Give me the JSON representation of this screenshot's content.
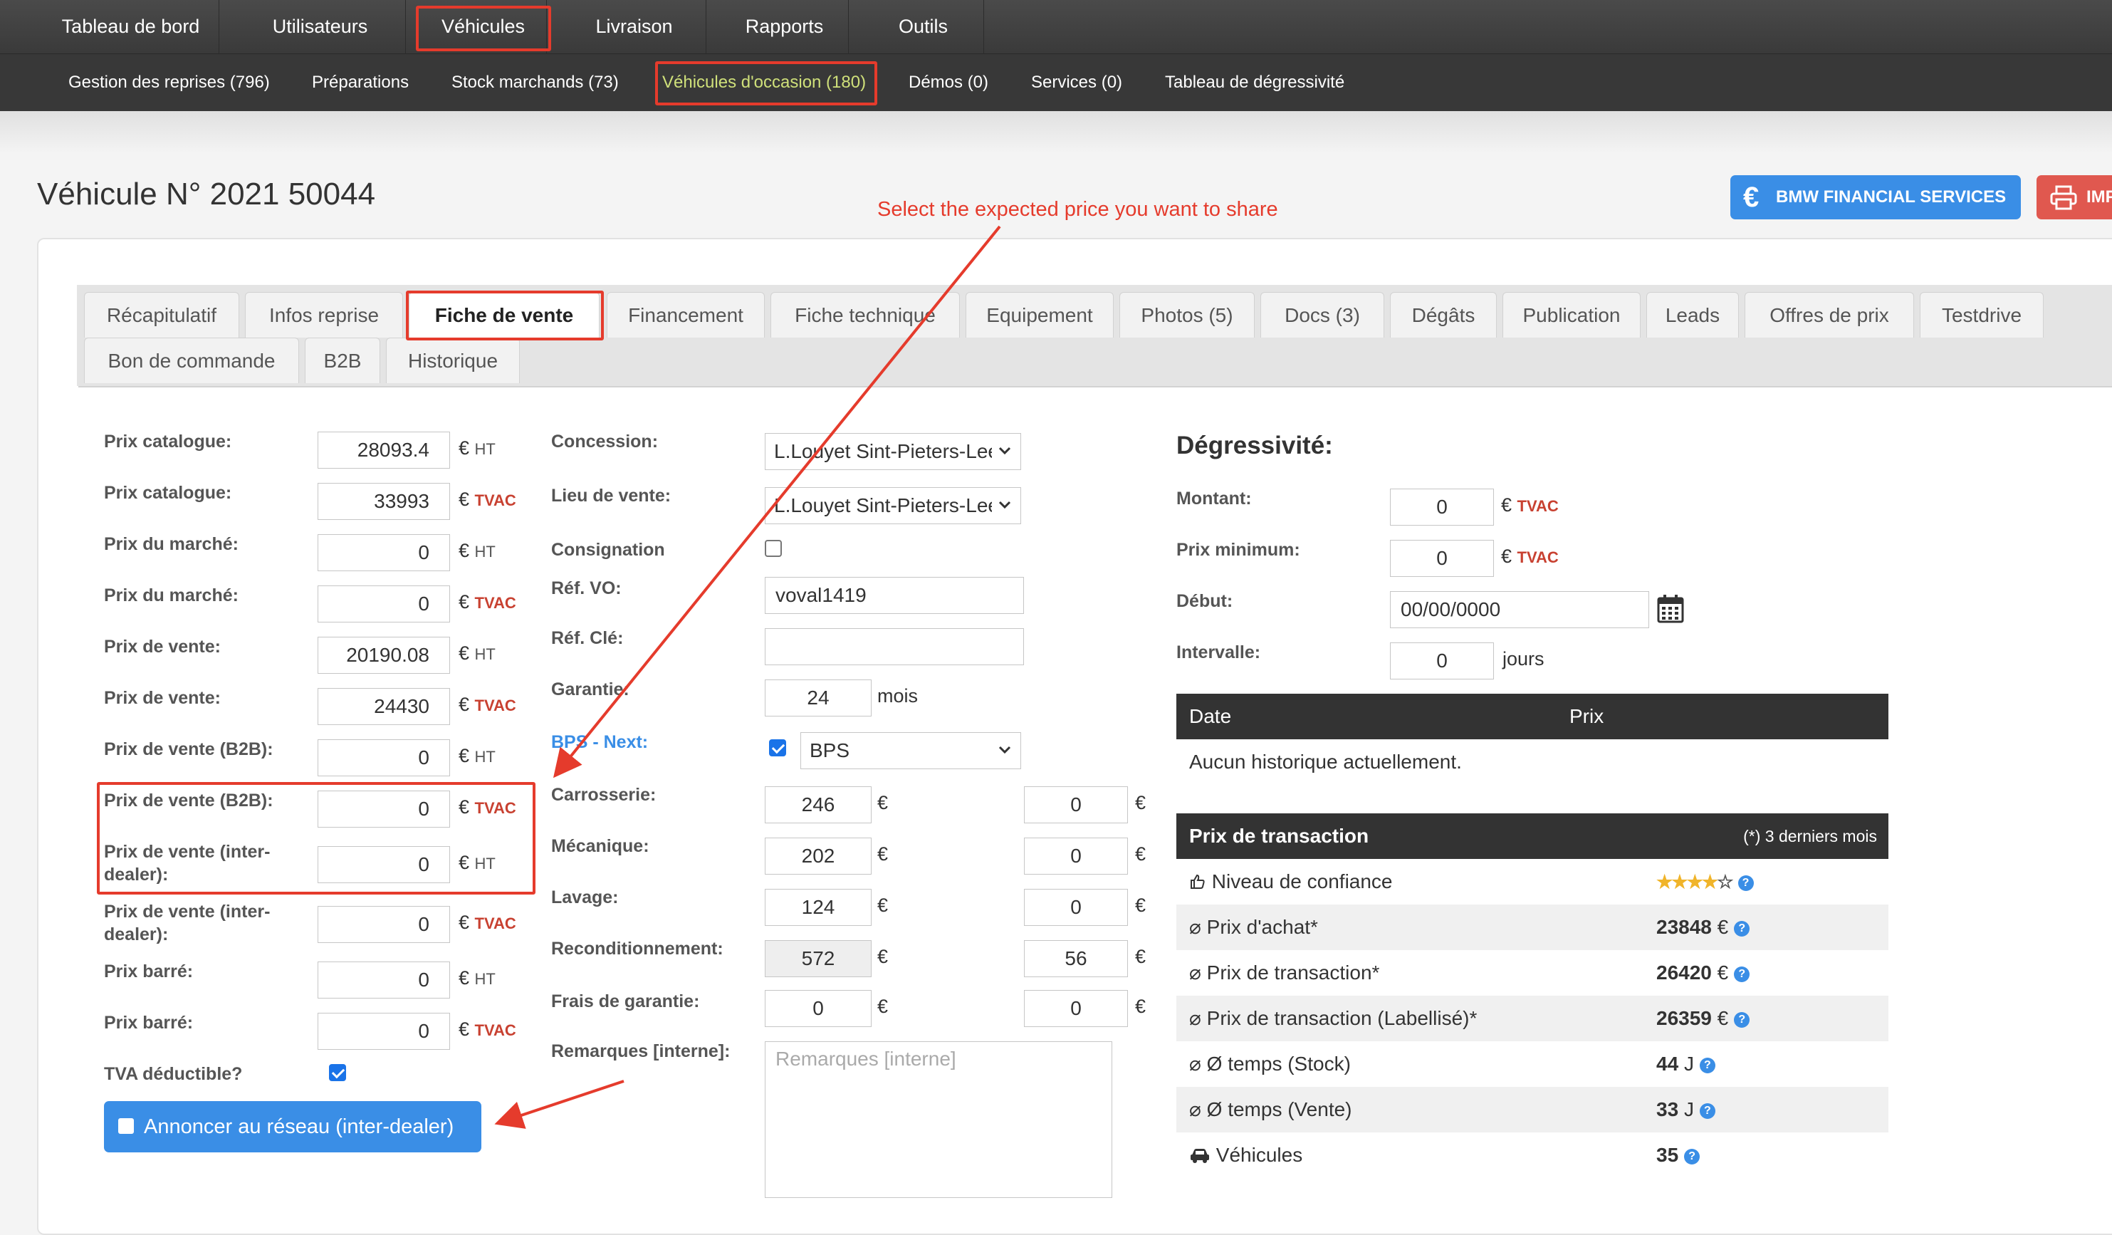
{
  "nav": {
    "main": [
      "Tableau de bord",
      "Utilisateurs",
      "Véhicules",
      "Livraison",
      "Rapports",
      "Outils"
    ],
    "sub": [
      "Gestion des reprises (796)",
      "Préparations",
      "Stock marchands (73)",
      "Véhicules d'occasion (180)",
      "Démos (0)",
      "Services (0)",
      "Tableau de dégressivité"
    ]
  },
  "page": {
    "title": "Véhicule N° 2021 50044",
    "bmw_button": "BMW FINANCIAL SERVICES",
    "euro_symbol": "€",
    "print_button": "IMP"
  },
  "annotation": {
    "text": "Select the expected price you want to share",
    "color": "#e53b2c"
  },
  "tabs": [
    "Récapitulatif",
    "Infos reprise",
    "Fiche de vente",
    "Financement",
    "Fiche technique",
    "Equipement",
    "Photos (5)",
    "Docs (3)",
    "Dégâts",
    "Publication",
    "Leads",
    "Offres de prix",
    "Testdrive",
    "Bon de commande",
    "B2B",
    "Historique"
  ],
  "units": {
    "euro": "€",
    "ht": "HT",
    "tvac": "TVAC",
    "mois": "mois",
    "jours": "jours"
  },
  "prices": [
    {
      "label": "Prix catalogue:",
      "value": "28093.4",
      "unit": "HT"
    },
    {
      "label": "Prix catalogue:",
      "value": "33993",
      "unit": "TVAC"
    },
    {
      "label": "Prix du marché:",
      "value": "0",
      "unit": "HT"
    },
    {
      "label": "Prix du marché:",
      "value": "0",
      "unit": "TVAC"
    },
    {
      "label": "Prix de vente:",
      "value": "20190.08",
      "unit": "HT"
    },
    {
      "label": "Prix de vente:",
      "value": "24430",
      "unit": "TVAC"
    },
    {
      "label": "Prix de vente (B2B):",
      "value": "0",
      "unit": "HT"
    },
    {
      "label": "Prix de vente (B2B):",
      "value": "0",
      "unit": "TVAC"
    },
    {
      "label": "Prix de vente (inter-dealer):",
      "value": "0",
      "unit": "HT"
    },
    {
      "label": "Prix de vente (inter-dealer):",
      "value": "0",
      "unit": "TVAC"
    },
    {
      "label": "Prix barré:",
      "value": "0",
      "unit": "HT"
    },
    {
      "label": "Prix barré:",
      "value": "0",
      "unit": "TVAC"
    }
  ],
  "tva": {
    "label": "TVA déductible?",
    "checked": true
  },
  "announce_button": "Annoncer au réseau (inter-dealer)",
  "middle": {
    "concession_label": "Concession:",
    "concession_value": "L.Louyet Sint-Pieters-Leeuw",
    "lieu_label": "Lieu de vente:",
    "lieu_value": "L.Louyet Sint-Pieters-Leeuw",
    "consignation_label": "Consignation",
    "ref_vo_label": "Réf. VO:",
    "ref_vo_value": "voval1419",
    "ref_cle_label": "Réf. Clé:",
    "ref_cle_value": "",
    "garantie_label": "Garantie:",
    "garantie_value": "24",
    "bps_label": "BPS - Next:",
    "bps_value": "BPS",
    "costs": [
      {
        "label": "Carrosserie:",
        "v1": "246",
        "v2": "0"
      },
      {
        "label": "Mécanique:",
        "v1": "202",
        "v2": "0"
      },
      {
        "label": "Lavage:",
        "v1": "124",
        "v2": "0"
      },
      {
        "label": "Reconditionnement:",
        "v1": "572",
        "v2": "56"
      },
      {
        "label": "Frais de garantie:",
        "v1": "0",
        "v2": "0"
      }
    ],
    "remarques_label": "Remarques [interne]:",
    "remarques_placeholder": "Remarques [interne]"
  },
  "degressivite": {
    "title": "Dégressivité:",
    "montant_label": "Montant:",
    "montant_value": "0",
    "prix_min_label": "Prix minimum:",
    "prix_min_value": "0",
    "debut_label": "Début:",
    "debut_value": "00/00/0000",
    "intervalle_label": "Intervalle:",
    "intervalle_value": "0",
    "table_headers": [
      "Date",
      "Prix"
    ],
    "empty_text": "Aucun historique actuellement."
  },
  "transaction": {
    "title": "Prix de transaction",
    "note": "(*) 3 derniers mois",
    "rows": [
      {
        "label": "Niveau de confiance",
        "stars": 4,
        "max_stars": 5
      },
      {
        "label": "⌀ Prix d'achat*",
        "value": "23848",
        "unit": "€"
      },
      {
        "label": "⌀ Prix de transaction*",
        "value": "26420",
        "unit": "€"
      },
      {
        "label": "⌀ Prix de transaction (Labellisé)*",
        "value": "26359",
        "unit": "€"
      },
      {
        "label": "⌀ Ø temps (Stock)",
        "value": "44",
        "unit": "J"
      },
      {
        "label": "⌀ Ø temps (Vente)",
        "value": "33",
        "unit": "J"
      },
      {
        "label": "Véhicules",
        "value": "35",
        "unit": ""
      }
    ]
  }
}
